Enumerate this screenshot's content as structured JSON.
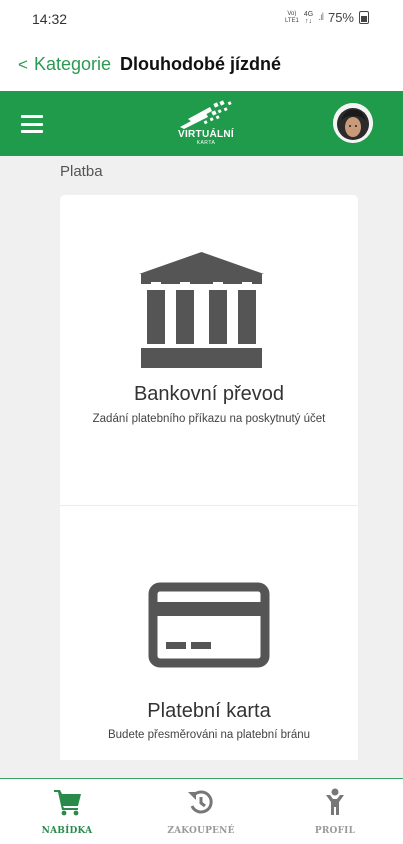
{
  "status_bar": {
    "time": "14:32",
    "network_top": "Vo)",
    "network_bottom": "LTE1",
    "network_type": "4G",
    "battery": "75%"
  },
  "nav": {
    "back_label": "Kategorie",
    "title": "Dlouhodobé jízdné"
  },
  "header": {
    "logo_text": "VIRTUÁLNÍ",
    "logo_subtext": "KARTA",
    "brand_color": "#1f9b4b"
  },
  "main": {
    "section_label": "Platba",
    "options": [
      {
        "icon": "bank-icon",
        "title": "Bankovní převod",
        "description": "Zadání platebního příkazu na poskytnutý účet"
      },
      {
        "icon": "credit-card-icon",
        "title": "Platební karta",
        "description": "Budete přesměrováni na platební bránu"
      }
    ]
  },
  "tabs": [
    {
      "label": "NABÍDKA",
      "icon": "cart-icon",
      "active": true
    },
    {
      "label": "ZAKOUPENÉ",
      "icon": "history-icon",
      "active": false
    },
    {
      "label": "PROFIL",
      "icon": "person-icon",
      "active": false
    }
  ],
  "colors": {
    "accent": "#2a9a52",
    "icon_gray": "#555555",
    "inactive_tab": "#999999"
  }
}
